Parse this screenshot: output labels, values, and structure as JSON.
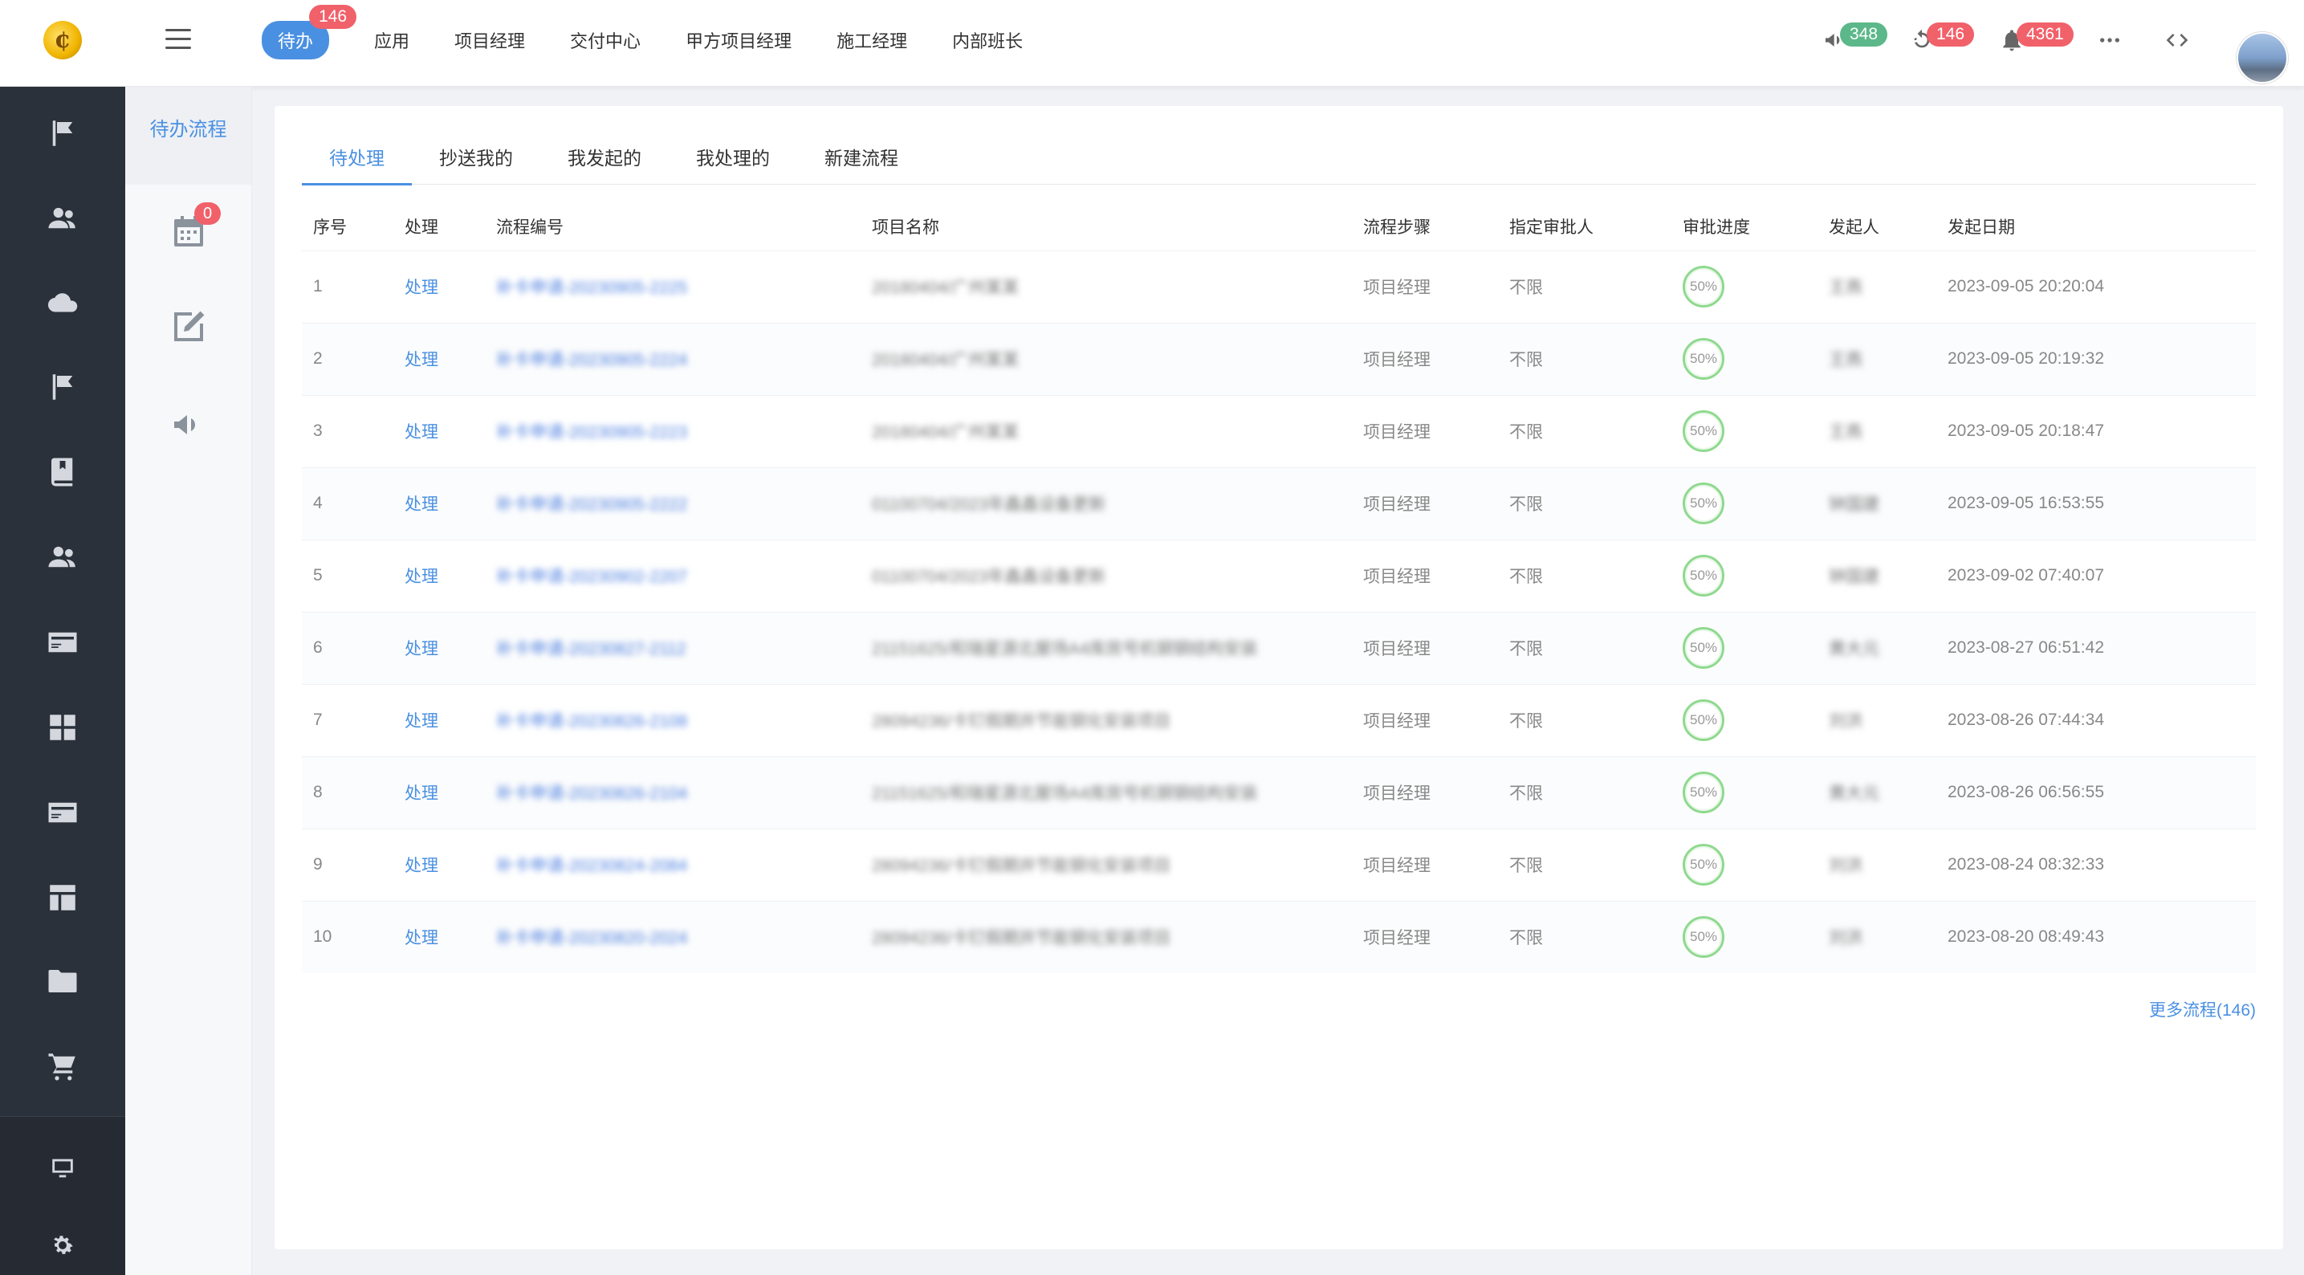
{
  "header": {
    "logo_char": "¢",
    "nav": [
      {
        "label": "待办",
        "badge": "146"
      },
      {
        "label": "应用"
      },
      {
        "label": "项目经理"
      },
      {
        "label": "交付中心"
      },
      {
        "label": "甲方项目经理"
      },
      {
        "label": "施工经理"
      },
      {
        "label": "内部班长"
      }
    ],
    "icons": [
      {
        "name": "announcement-icon",
        "badge": "348"
      },
      {
        "name": "refresh-icon",
        "badge": "146"
      },
      {
        "name": "bell-icon",
        "badge": "4361"
      },
      {
        "name": "more-icon"
      },
      {
        "name": "code-icon"
      }
    ]
  },
  "subnav": {
    "title": "待办流程",
    "calendar_badge": "0"
  },
  "tabs": [
    "待处理",
    "抄送我的",
    "我发起的",
    "我处理的",
    "新建流程"
  ],
  "table": {
    "columns": [
      "序号",
      "处理",
      "流程编号",
      "项目名称",
      "流程步骤",
      "指定审批人",
      "审批进度",
      "发起人",
      "发起日期"
    ],
    "rows": [
      {
        "no": "1",
        "action": "处理",
        "flow_no": "补卡申请-20230905-2225",
        "project": "20180404/广州某某",
        "step": "项目经理",
        "approver": "不限",
        "progress": "50%",
        "initiator": "王燕",
        "date": "2023-09-05 20:20:04"
      },
      {
        "no": "2",
        "action": "处理",
        "flow_no": "补卡申请-20230905-2224",
        "project": "20180404/广州某某",
        "step": "项目经理",
        "approver": "不限",
        "progress": "50%",
        "initiator": "王燕",
        "date": "2023-09-05 20:19:32"
      },
      {
        "no": "3",
        "action": "处理",
        "flow_no": "补卡申请-20230905-2223",
        "project": "20180404/广州某某",
        "step": "项目经理",
        "approver": "不限",
        "progress": "50%",
        "initiator": "王燕",
        "date": "2023-09-05 20:18:47"
      },
      {
        "no": "4",
        "action": "处理",
        "flow_no": "补卡申请-20230905-2222",
        "project": "01100704/2023年鑫鑫设备更新",
        "step": "项目经理",
        "approver": "不限",
        "progress": "50%",
        "initiator": "钟国建",
        "date": "2023-09-05 16:53:55"
      },
      {
        "no": "5",
        "action": "处理",
        "flow_no": "补卡申请-20230902-2207",
        "project": "01100704/2023年鑫鑫设备更新",
        "step": "项目经理",
        "approver": "不限",
        "progress": "50%",
        "initiator": "钟国建",
        "date": "2023-09-02 07:40:07"
      },
      {
        "no": "6",
        "action": "处理",
        "flow_no": "补卡申请-20230827-2112",
        "project": "21151625/和瑞星源北屋场A4库房号机钢钢结构安装",
        "step": "项目经理",
        "approver": "不限",
        "progress": "50%",
        "initiator": "黄大元",
        "date": "2023-08-27 06:51:42"
      },
      {
        "no": "7",
        "action": "处理",
        "flow_no": "补卡申请-20230826-2108",
        "project": "28094236/卡钉假期并节能钢化安装项目",
        "step": "项目经理",
        "approver": "不限",
        "progress": "50%",
        "initiator": "刘洪",
        "date": "2023-08-26 07:44:34"
      },
      {
        "no": "8",
        "action": "处理",
        "flow_no": "补卡申请-20230826-2104",
        "project": "21151625/和瑞星源北屋场A4库房号机钢钢结构安装",
        "step": "项目经理",
        "approver": "不限",
        "progress": "50%",
        "initiator": "黄大元",
        "date": "2023-08-26 06:56:55"
      },
      {
        "no": "9",
        "action": "处理",
        "flow_no": "补卡申请-20230824-2084",
        "project": "28094236/卡钉假期并节能钢化安装项目",
        "step": "项目经理",
        "approver": "不限",
        "progress": "50%",
        "initiator": "刘洪",
        "date": "2023-08-24 08:32:33"
      },
      {
        "no": "10",
        "action": "处理",
        "flow_no": "补卡申请-20230820-2024",
        "project": "28094236/卡钉假期并节能钢化安装项目",
        "step": "项目经理",
        "approver": "不限",
        "progress": "50%",
        "initiator": "刘洪",
        "date": "2023-08-20 08:49:43"
      }
    ]
  },
  "more_link": "更多流程(146)",
  "colors": {
    "accent": "#4a90e2",
    "badge_red": "#f0616a",
    "badge_green": "#5cb88a",
    "sidebar": "#2b313a",
    "progress_ring": "#8fd98f"
  }
}
